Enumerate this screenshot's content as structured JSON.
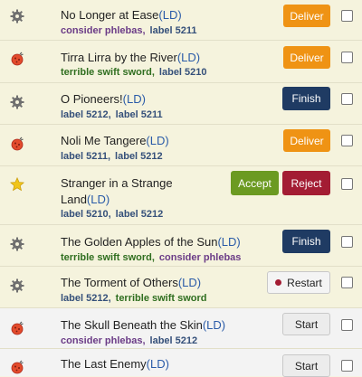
{
  "stories": [
    {
      "title": "No Longer at Ease",
      "ld": "(LD)",
      "icon": "gear-icon",
      "labels": [
        {
          "text": "consider phlebas,",
          "color": "purple"
        },
        {
          "text": "label 5211",
          "color": "blue"
        }
      ],
      "button": {
        "label": "Deliver",
        "kind": "deliver"
      }
    },
    {
      "title": "Tirra Lirra by the River",
      "ld": "(LD)",
      "icon": "bug-icon",
      "labels": [
        {
          "text": "terrible swift sword,",
          "color": "green"
        },
        {
          "text": "label 5210",
          "color": "blue"
        }
      ],
      "button": {
        "label": "Deliver",
        "kind": "deliver"
      }
    },
    {
      "title": "O Pioneers!",
      "ld": "(LD)",
      "icon": "gear-icon",
      "labels": [
        {
          "text": "label 5212,",
          "color": "blue"
        },
        {
          "text": "label 5211",
          "color": "blue"
        }
      ],
      "button": {
        "label": "Finish",
        "kind": "finish"
      }
    },
    {
      "title": "Noli Me Tangere",
      "ld": "(LD)",
      "icon": "bug-icon",
      "labels": [
        {
          "text": "label 5211,",
          "color": "blue"
        },
        {
          "text": "label 5212",
          "color": "blue"
        }
      ],
      "button": {
        "label": "Deliver",
        "kind": "deliver"
      }
    },
    {
      "title_line1": "Stranger in a Strange",
      "title_line2": "Land",
      "ld": "(LD)",
      "icon": "star-icon",
      "labels": [
        {
          "text": "label 5210,",
          "color": "blue"
        },
        {
          "text": "label 5212",
          "color": "blue"
        }
      ],
      "accept_label": "Accept",
      "reject_label": "Reject"
    },
    {
      "title": "The Golden Apples of the Sun",
      "ld": "(LD)",
      "icon": "gear-icon",
      "labels": [
        {
          "text": "terrible swift sword,",
          "color": "green"
        },
        {
          "text": "consider phlebas",
          "color": "purple"
        }
      ],
      "button": {
        "label": "Finish",
        "kind": "finish"
      }
    },
    {
      "title": "The Torment of Others",
      "ld": "(LD)",
      "icon": "gear-icon",
      "labels": [
        {
          "text": "label 5212,",
          "color": "blue"
        },
        {
          "text": "terrible swift sword",
          "color": "green"
        }
      ],
      "button": {
        "label": "Restart",
        "kind": "restart"
      }
    },
    {
      "title": "The Skull Beneath the Skin",
      "ld": "(LD)",
      "icon": "bug-icon",
      "labels": [
        {
          "text": "consider phlebas,",
          "color": "purple"
        },
        {
          "text": "label 5212",
          "color": "blue"
        }
      ],
      "button": {
        "label": "Start",
        "kind": "start"
      }
    },
    {
      "title": "The Last Enemy",
      "ld": "(LD)",
      "icon": "bug-icon",
      "labels": [],
      "button": {
        "label": "Start",
        "kind": "start"
      }
    }
  ]
}
